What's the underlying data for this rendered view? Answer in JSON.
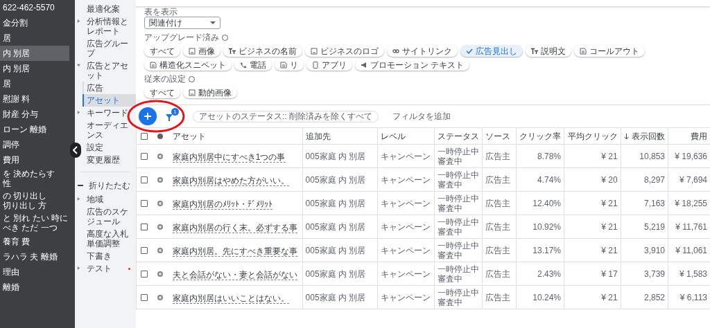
{
  "campaigns": [
    {
      "lines": [
        "622-462-5570"
      ],
      "selected": false
    },
    {
      "lines": [
        "金分割"
      ],
      "selected": false
    },
    {
      "lines": [
        "居"
      ],
      "selected": false
    },
    {
      "lines": [
        "内 別居"
      ],
      "selected": true
    },
    {
      "lines": [
        "内 別居"
      ],
      "selected": false
    },
    {
      "lines": [
        "居"
      ],
      "selected": false
    },
    {
      "lines": [
        "慰謝 料"
      ],
      "selected": false
    },
    {
      "lines": [
        "財産 分与"
      ],
      "selected": false
    },
    {
      "lines": [
        "ローン 離婚"
      ],
      "selected": false
    },
    {
      "lines": [
        "調停"
      ],
      "selected": false
    },
    {
      "lines": [
        "費用"
      ],
      "selected": false
    },
    {
      "lines": [
        "を 決めたらす",
        "性"
      ],
      "selected": false
    },
    {
      "lines": [
        "の 切り出し",
        "切り出し 方"
      ],
      "selected": false
    },
    {
      "lines": [
        "と 別れ たい 時に",
        "べき ただ 一つ"
      ],
      "selected": false
    },
    {
      "lines": [
        "養育 費"
      ],
      "selected": false
    },
    {
      "lines": [
        "ラハラ 夫 離婚"
      ],
      "selected": false
    },
    {
      "lines": [
        "理由"
      ],
      "selected": false
    },
    {
      "lines": [
        "離婚"
      ],
      "selected": false
    }
  ],
  "nav": {
    "items": [
      {
        "label": "最適化案",
        "selected": false
      },
      {
        "label": "分析情報とレポート",
        "selected": false,
        "expanded": false
      },
      {
        "label": "広告グループ",
        "selected": false
      },
      {
        "label": "広告とアセット",
        "selected": false,
        "expanded": true,
        "children": [
          {
            "label": "広告",
            "selected": false
          },
          {
            "label": "アセット",
            "selected": true
          }
        ]
      },
      {
        "label": "キーワード",
        "selected": false,
        "expanded": false
      },
      {
        "label": "オーディエンス",
        "selected": false
      },
      {
        "label": "設定",
        "selected": false
      },
      {
        "label": "変更履歴",
        "selected": false
      }
    ],
    "collapse_label": "折りたたむ",
    "more_items": [
      {
        "label": "地域",
        "selected": false,
        "expanded": false
      },
      {
        "label": "広告のスケジュール",
        "selected": false
      },
      {
        "label": "高度な入札単価調整",
        "selected": false
      },
      {
        "label": "下書き",
        "selected": false
      },
      {
        "label": "テスト",
        "selected": false,
        "expanded": false,
        "notice": true
      }
    ]
  },
  "view": {
    "label": "表を表示",
    "value": "関連付け"
  },
  "upgraded": {
    "label": "アップグレード済み",
    "chips": [
      {
        "label": "すべて",
        "kind": "plain",
        "selected": false
      },
      {
        "label": "画像",
        "kind": "image",
        "selected": false
      },
      {
        "label": "ビジネスの名前",
        "kind": "text",
        "selected": false
      },
      {
        "label": "ビジネスのロゴ",
        "kind": "image",
        "selected": false
      },
      {
        "label": "サイトリンク",
        "kind": "link",
        "selected": false
      },
      {
        "label": "広告見出し",
        "selected": true
      },
      {
        "label": "説明文",
        "kind": "text",
        "selected": false
      },
      {
        "label": "コールアウト",
        "kind": "doc",
        "selected": false
      },
      {
        "label": "構造化スニペット",
        "kind": "doc",
        "selected": false
      },
      {
        "label": "電話",
        "kind": "phone",
        "selected": false
      },
      {
        "label": "リ",
        "kind": "doc",
        "selected": false
      },
      {
        "label": "アプリ",
        "kind": "app",
        "selected": false
      },
      {
        "label": "プロモーション テキスト",
        "kind": "promo",
        "selected": false
      }
    ]
  },
  "legacy": {
    "label": "従来の設定",
    "chips": [
      {
        "label": "すべて",
        "kind": "plain",
        "selected": false
      },
      {
        "label": "動的画像",
        "kind": "image",
        "selected": false
      }
    ]
  },
  "toolbar": {
    "filter_count": "1",
    "filter_chip": "アセットのステータス:: 削除済みを除くすべて",
    "add_filter": "フィルタを追加"
  },
  "table": {
    "all_checked": false,
    "columns": [
      "アセット",
      "追加先",
      "レベル",
      "ステータス",
      "ソース",
      "クリック率",
      "平均クリック",
      "表示回数",
      "費用"
    ],
    "rows": [
      {
        "checked": false,
        "asset": "家庭内別居中にすべき1つの事",
        "added_to": "005家庭 内 別居",
        "level": "キャンペーン",
        "status": [
          "一時停止中",
          "審査中"
        ],
        "source": "広告主",
        "ctr": "8.78%",
        "avg_cpc": "¥ 21",
        "impressions": "10,853",
        "cost": "¥ 19,636"
      },
      {
        "checked": false,
        "asset": "家庭内別居はやめた方がいい。",
        "added_to": "005家庭 内 別居",
        "level": "キャンペーン",
        "status": [
          "一時停止中",
          "審査中"
        ],
        "source": "広告主",
        "ctr": "4.74%",
        "avg_cpc": "¥ 20",
        "impressions": "8,297",
        "cost": "¥ 7,694"
      },
      {
        "checked": false,
        "asset": "家庭内別居のﾒﾘｯﾄ・ﾃﾞﾒﾘｯﾄ",
        "added_to": "005家庭 内 別居",
        "level": "キャンペーン",
        "status": [
          "一時停止中",
          "審査中"
        ],
        "source": "広告主",
        "ctr": "12.40%",
        "avg_cpc": "¥ 21",
        "impressions": "7,163",
        "cost": "¥ 18,255"
      },
      {
        "checked": false,
        "asset": "家庭内別居の行く末。必ずする事",
        "added_to": "005家庭 内 別居",
        "level": "キャンペーン",
        "status": [
          "一時停止中",
          "審査中"
        ],
        "source": "広告主",
        "ctr": "10.92%",
        "avg_cpc": "¥ 21",
        "impressions": "5,219",
        "cost": "¥ 11,761"
      },
      {
        "checked": false,
        "asset": "家庭内別居。先にすべき重要な事",
        "added_to": "005家庭 内 別居",
        "level": "キャンペーン",
        "status": [
          "一時停止中",
          "審査中"
        ],
        "source": "広告主",
        "ctr": "13.17%",
        "avg_cpc": "¥ 21",
        "impressions": "3,910",
        "cost": "¥ 11,061"
      },
      {
        "checked": false,
        "asset": "夫と会話がない・妻と会話がない",
        "added_to": "005家庭 内 別居",
        "level": "キャンペーン",
        "status": [
          "一時停止中",
          "審査中"
        ],
        "source": "広告主",
        "ctr": "2.43%",
        "avg_cpc": "¥ 17",
        "impressions": "3,739",
        "cost": "¥ 1,583"
      },
      {
        "checked": false,
        "asset": "家庭内別居はいいことはない。",
        "added_to": "005家庭 内 別居",
        "level": "キャンペーン",
        "status": [
          "一時停止中",
          "審査中"
        ],
        "source": "広告主",
        "ctr": "10.24%",
        "avg_cpc": "¥ 21",
        "impressions": "2,852",
        "cost": "¥ 6,113"
      }
    ]
  }
}
